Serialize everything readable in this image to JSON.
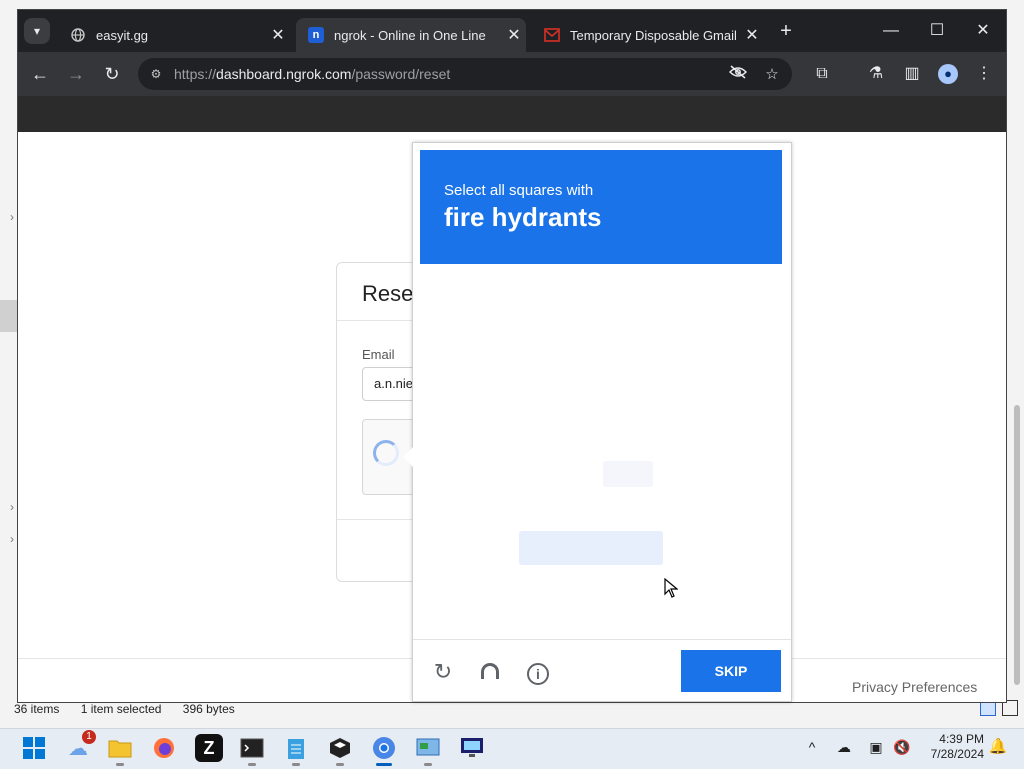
{
  "browser": {
    "tabs": [
      {
        "title": "easyit.gg",
        "favicon": "globe-icon"
      },
      {
        "title": "ngrok - Online in One Line",
        "favicon": "ngrok-logo-icon",
        "active": true
      },
      {
        "title": "Temporary Disposable Gmail |",
        "favicon": "gmail-box-icon"
      }
    ],
    "url": {
      "scheme": "https://",
      "host": "dashboard.ngrok.com",
      "path": "/password/reset"
    }
  },
  "page": {
    "card_title": "Rese",
    "email_label": "Email",
    "email_value": "a.n.nie",
    "privacy_link": "Privacy Preferences"
  },
  "captcha": {
    "prompt_sub": "Select all squares with",
    "prompt_object": "fire hydrants",
    "skip_label": "SKIP",
    "accent": "#1a73e8"
  },
  "explorer": {
    "items_count": "36 items",
    "selected": "1 item selected",
    "size": "396 bytes"
  },
  "taskbar": {
    "time": "4:39 PM",
    "date": "7/28/2024",
    "weather_badge": "1"
  }
}
